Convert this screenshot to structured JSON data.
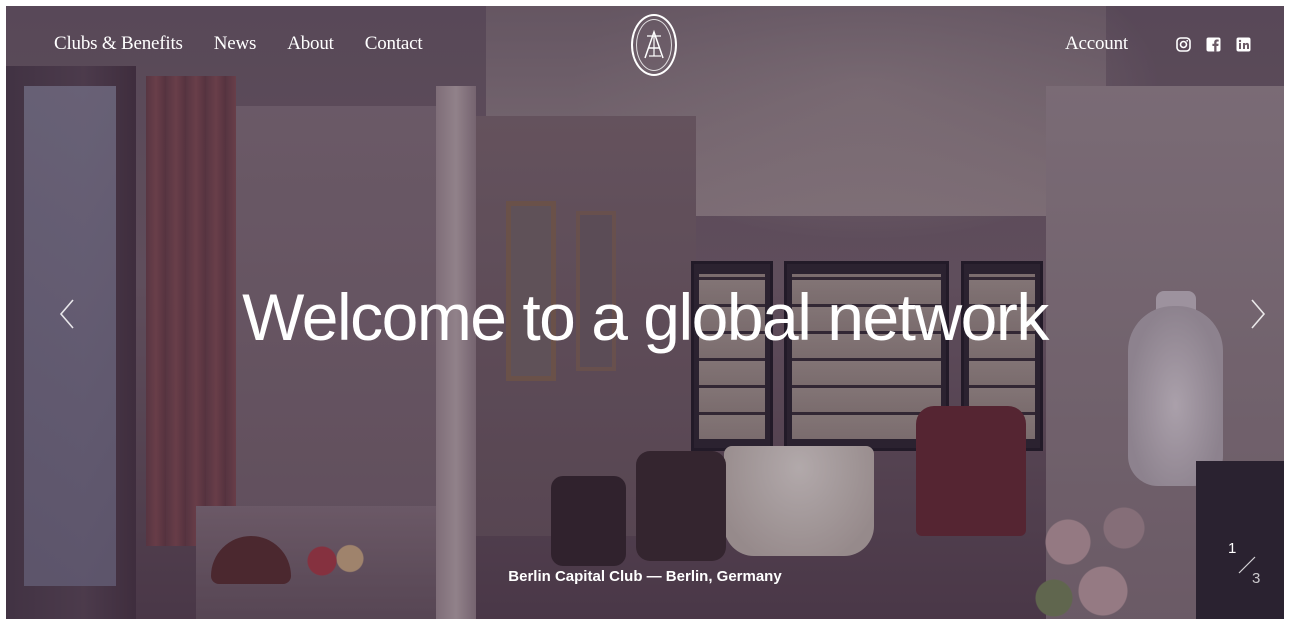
{
  "nav": {
    "items": [
      {
        "label": "Clubs & Benefits"
      },
      {
        "label": "News"
      },
      {
        "label": "About"
      },
      {
        "label": "Contact"
      }
    ],
    "account_label": "Account",
    "socials": [
      {
        "icon": "instagram-icon"
      },
      {
        "icon": "facebook-icon"
      },
      {
        "icon": "linkedin-icon"
      }
    ]
  },
  "hero": {
    "headline": "Welcome to a global network",
    "caption": "Berlin Capital Club — Berlin, Germany",
    "slide_current": "1",
    "slide_total": "3"
  },
  "icons": {
    "prev": "chevron-left-icon",
    "next": "chevron-right-icon",
    "logo": "club-monogram-logo"
  },
  "colors": {
    "text": "#ffffff",
    "overlay": "#281c32"
  }
}
